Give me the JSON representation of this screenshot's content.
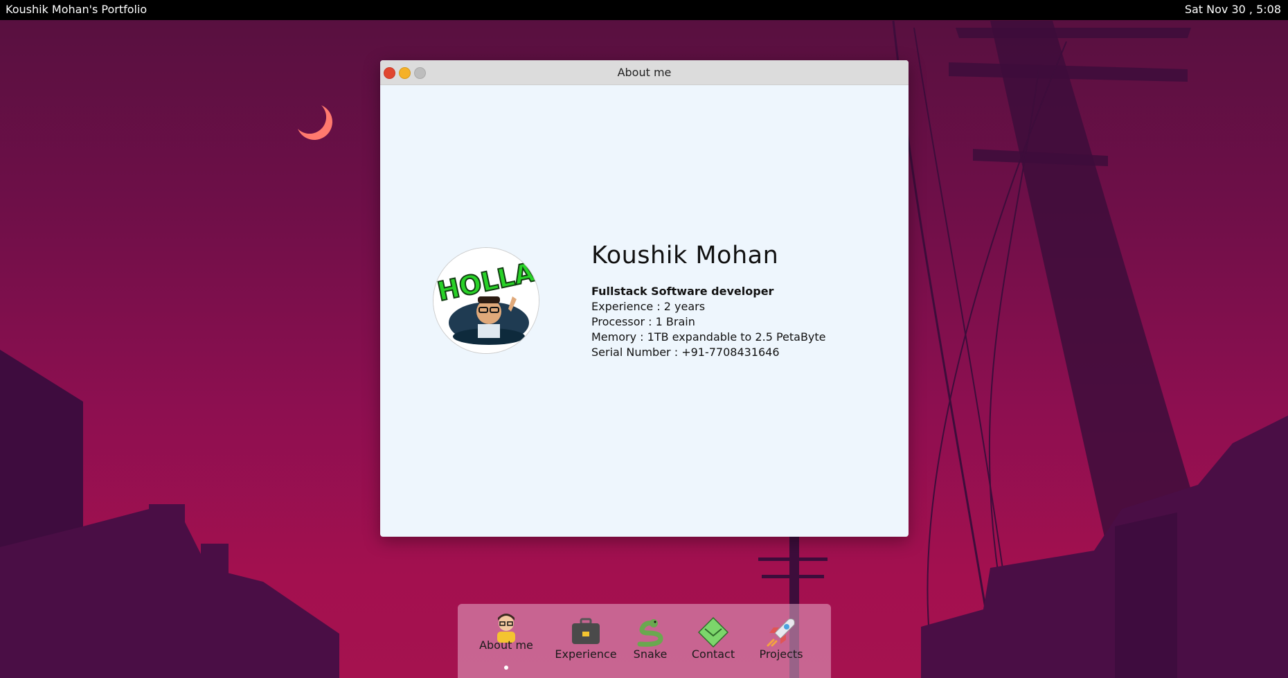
{
  "menubar": {
    "app_title": "Koushik Mohan's Portfolio",
    "datetime": "Sat Nov 30 , 5:08"
  },
  "window": {
    "title": "About me",
    "buttons": [
      "close",
      "minimize",
      "maximize"
    ]
  },
  "profile": {
    "avatar_text": "HOLLA",
    "name": "Koushik Mohan",
    "role": "Fullstack Software developer",
    "details": [
      "Experience : 2 years",
      "Processor : 1 Brain",
      "Memory : 1TB expandable to 2.5 PetaByte",
      "Serial Number : +91-7708431646"
    ]
  },
  "dock": {
    "items": [
      {
        "label": "About me",
        "icon": "person-icon",
        "active": true
      },
      {
        "label": "Experience",
        "icon": "briefcase-icon",
        "active": false
      },
      {
        "label": "Snake",
        "icon": "snake-icon",
        "active": false
      },
      {
        "label": "Contact",
        "icon": "mail-icon",
        "active": false
      },
      {
        "label": "Projects",
        "icon": "rocket-icon",
        "active": false
      }
    ]
  },
  "colors": {
    "accent_moon": "#ff7a6e",
    "close": "#e0462f",
    "minimize": "#f5b128",
    "window_bg": "#eef6fd"
  }
}
